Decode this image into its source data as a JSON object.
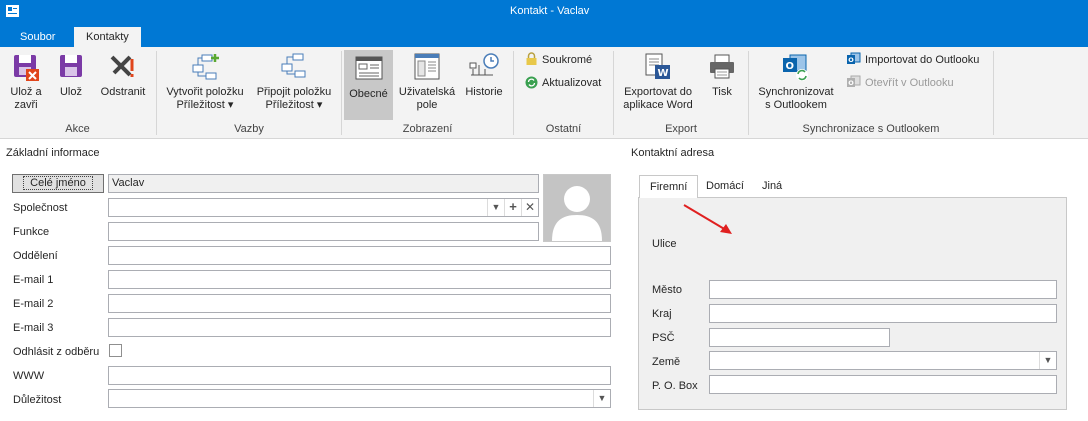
{
  "window": {
    "title": "Kontakt - Vaclav"
  },
  "tabs": [
    {
      "label": "Soubor"
    },
    {
      "label": "Kontakty"
    }
  ],
  "ribbon": {
    "groups": {
      "akce": "Akce",
      "vazby": "Vazby",
      "zobrazeni": "Zobrazení",
      "ostatni": "Ostatní",
      "export": "Export",
      "sync": "Synchronizace s Outlookem"
    },
    "buttons": {
      "save_close_1": "Ulož a",
      "save_close_2": "zavři",
      "save": "Ulož",
      "delete": "Odstranit",
      "create_opp_1": "Vytvořit položku",
      "create_opp_2": "Příležitost",
      "attach_opp_1": "Připojit položku",
      "attach_opp_2": "Příležitost",
      "general": "Obecné",
      "user_fields_1": "Uživatelská",
      "user_fields_2": "pole",
      "history": "Historie",
      "private": "Soukromé",
      "refresh": "Aktualizovat",
      "export_word_1": "Exportovat do",
      "export_word_2": "aplikace Word",
      "print": "Tisk",
      "sync_1": "Synchronizovat",
      "sync_2": "s Outlookem",
      "import_outlook": "Importovat do Outlooku",
      "open_outlook": "Otevřít v Outlooku"
    }
  },
  "basic": {
    "title": "Základní informace",
    "full_name_button": "Celé jméno",
    "full_name_value": "Vaclav",
    "fields": {
      "company": "Společnost",
      "function": "Funkce",
      "department": "Oddělení",
      "email1": "E-mail 1",
      "email2": "E-mail 2",
      "email3": "E-mail 3",
      "unsubscribe": "Odhlásit z odběru",
      "www": "WWW",
      "importance": "Důležitost"
    }
  },
  "address": {
    "title": "Kontaktní adresa",
    "tabs": [
      "Firemní",
      "Domácí",
      "Jiná"
    ],
    "fields": {
      "street": "Ulice",
      "city": "Město",
      "region": "Kraj",
      "zip": "PSČ",
      "country": "Země",
      "pobox": "P. O. Box"
    }
  },
  "colors": {
    "accent": "#0078d4",
    "ribbon_bg": "#f3f3f3",
    "annotation_arrow": "#e02020"
  }
}
